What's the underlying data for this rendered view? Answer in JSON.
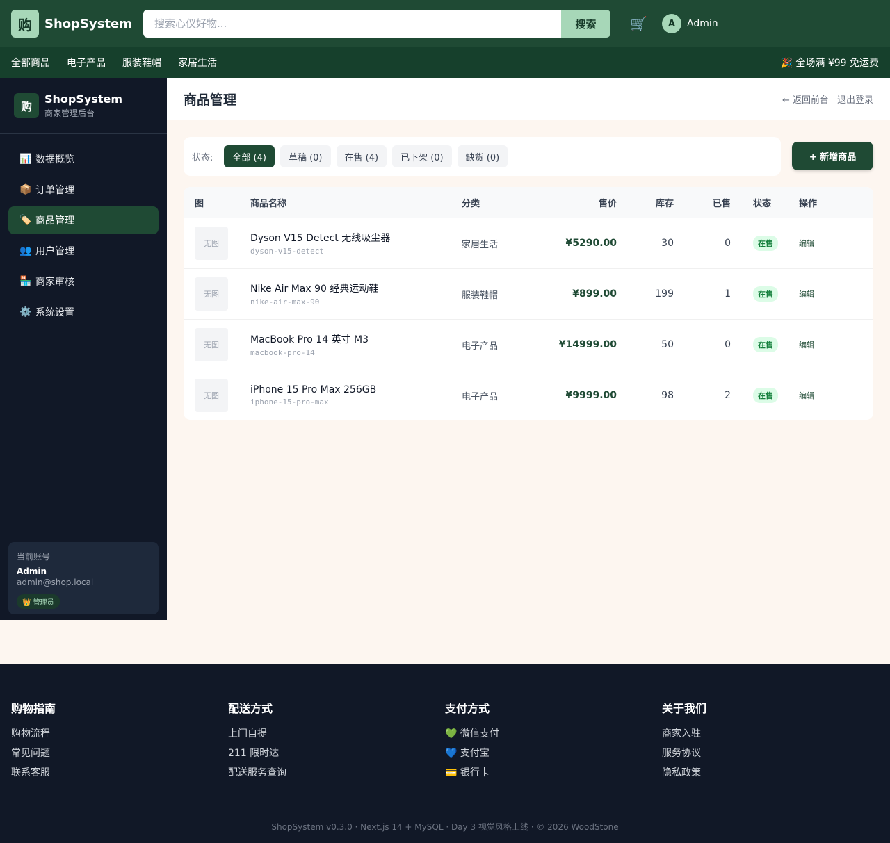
{
  "header": {
    "logo": "购",
    "brand": "ShopSystem",
    "search_placeholder": "搜索心仪好物...",
    "search_button": "搜索",
    "cart_icon": "🛒",
    "avatar_initial": "A",
    "username": "Admin"
  },
  "categories": [
    "全部商品",
    "电子产品",
    "服装鞋帽",
    "家居生活"
  ],
  "promo": "🎉 全场满 ¥99 免运费",
  "sidebar": {
    "logo": "购",
    "title": "ShopSystem",
    "subtitle": "商家管理后台",
    "items": [
      {
        "icon": "📊",
        "label": "数据概览"
      },
      {
        "icon": "📦",
        "label": "订单管理"
      },
      {
        "icon": "🏷️",
        "label": "商品管理"
      },
      {
        "icon": "👥",
        "label": "用户管理"
      },
      {
        "icon": "🏪",
        "label": "商家审核"
      },
      {
        "icon": "⚙️",
        "label": "系统设置"
      }
    ],
    "account": {
      "label": "当前账号",
      "name": "Admin",
      "email": "admin@shop.local",
      "role": "👑 管理员"
    }
  },
  "main": {
    "title": "商品管理",
    "back_link": "← 返回前台",
    "logout": "退出登录",
    "filter_label": "状态:",
    "filters": [
      "全部 (4)",
      "草稿 (0)",
      "在售 (4)",
      "已下架 (0)",
      "缺货 (0)"
    ],
    "add_button": "+ 新增商品",
    "columns": [
      "图",
      "商品名称",
      "分类",
      "售价",
      "库存",
      "已售",
      "状态",
      "操作"
    ],
    "rows": [
      {
        "img": "无图",
        "name": "Dyson V15 Detect 无线吸尘器",
        "slug": "dyson-v15-detect",
        "category": "家居生活",
        "price": "¥5290.00",
        "stock": "30",
        "sold": "0",
        "status": "在售",
        "op": "编辑"
      },
      {
        "img": "无图",
        "name": "Nike Air Max 90 经典运动鞋",
        "slug": "nike-air-max-90",
        "category": "服装鞋帽",
        "price": "¥899.00",
        "stock": "199",
        "sold": "1",
        "status": "在售",
        "op": "编辑"
      },
      {
        "img": "无图",
        "name": "MacBook Pro 14 英寸 M3",
        "slug": "macbook-pro-14",
        "category": "电子产品",
        "price": "¥14999.00",
        "stock": "50",
        "sold": "0",
        "status": "在售",
        "op": "编辑"
      },
      {
        "img": "无图",
        "name": "iPhone 15 Pro Max 256GB",
        "slug": "iphone-15-pro-max",
        "category": "电子产品",
        "price": "¥9999.00",
        "stock": "98",
        "sold": "2",
        "status": "在售",
        "op": "编辑"
      }
    ]
  },
  "footer": {
    "columns": [
      {
        "title": "购物指南",
        "items": [
          "购物流程",
          "常见问题",
          "联系客服"
        ]
      },
      {
        "title": "配送方式",
        "items": [
          "上门自提",
          "211 限时达",
          "配送服务查询"
        ]
      },
      {
        "title": "支付方式",
        "items": [
          "💚 微信支付",
          "💙 支付宝",
          "💳 银行卡"
        ]
      },
      {
        "title": "关于我们",
        "items": [
          "商家入驻",
          "服务协议",
          "隐私政策"
        ]
      }
    ],
    "copyright": "ShopSystem v0.3.0 · Next.js 14 + MySQL · Day 3 视觉风格上线 · © 2026 WoodStone"
  },
  "colors": {
    "primary": "#1f4a34",
    "accent": "#a7d7b8",
    "sidebar_bg": "#111827",
    "page_bg": "#fdf6f0",
    "status_green": "#15803d"
  }
}
